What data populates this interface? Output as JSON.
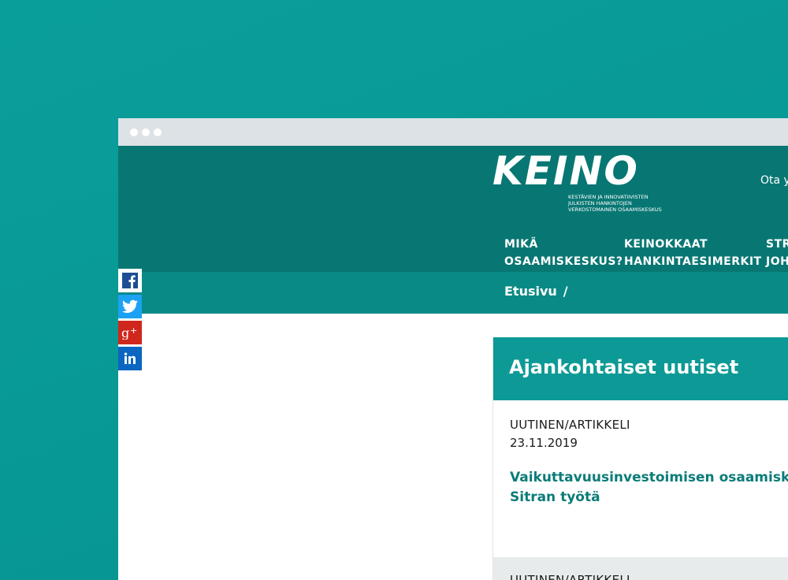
{
  "logo": {
    "word": "KEINO",
    "tagline_lines": [
      "KESTÄVIEN JA INNOVATIIVISTEN",
      "JULKISTEN HANKINTOJEN",
      "VERKOSTOMAINEN OSAAMISKESKUS"
    ]
  },
  "header": {
    "contact_text": "Ota y"
  },
  "nav": [
    {
      "line1": "MIKÄ",
      "line2": "OSAAMISKESKUS?"
    },
    {
      "line1": "KEINOKKAAT",
      "line2": "HANKINTAESIMERKIT"
    },
    {
      "line1": "STR",
      "line2": "JOH"
    }
  ],
  "breadcrumb": {
    "home": "Etusivu",
    "separator": "/"
  },
  "social": [
    "facebook-icon",
    "twitter-icon",
    "google-plus-icon",
    "linkedin-icon"
  ],
  "news": {
    "title": "Ajankohtaiset uutiset",
    "items": [
      {
        "category": "UUTINEN/ARTIKKELI",
        "date": "23.11.2019",
        "headline": "Vaikuttavuusinvestoimisen osaamiskesku\nSitran työtä"
      },
      {
        "category": "UUTINEN/ARTIKKELI"
      }
    ]
  },
  "colors": {
    "page_bg": "#0a9e9a",
    "header_bg": "#087773",
    "breadcrumb_bg": "#0a8a86",
    "news_header_bg": "#0d9a96",
    "link": "#0a7c78"
  }
}
